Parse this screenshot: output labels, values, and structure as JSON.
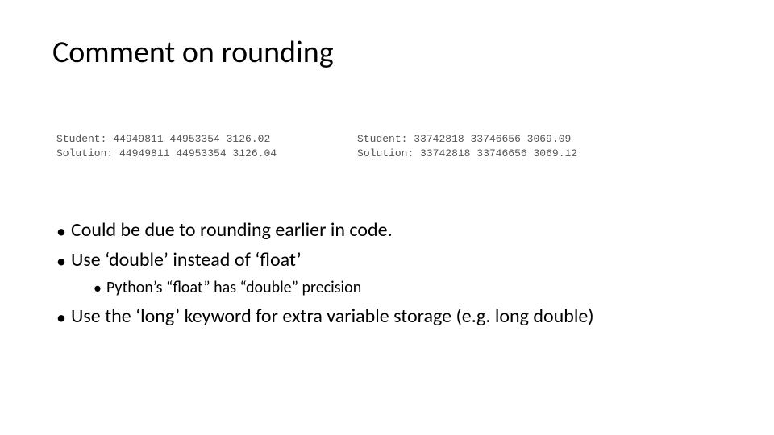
{
  "title": "Comment on rounding",
  "code_left": {
    "student": "Student: 44949811 44953354 3126.02",
    "solution": "Solution: 44949811 44953354 3126.04"
  },
  "code_right": {
    "student": "Student: 33742818 33746656 3069.09",
    "solution": "Solution: 33742818 33746656 3069.12"
  },
  "bullets": {
    "b1": "Could be due to rounding earlier in code.",
    "b2": "Use ‘double’ instead of ‘float’",
    "b2a": "Python’s “float” has “double” precision",
    "b3": "Use the ‘long’ keyword for extra variable storage (e.g. long double)"
  },
  "glyphs": {
    "dot": "•"
  }
}
